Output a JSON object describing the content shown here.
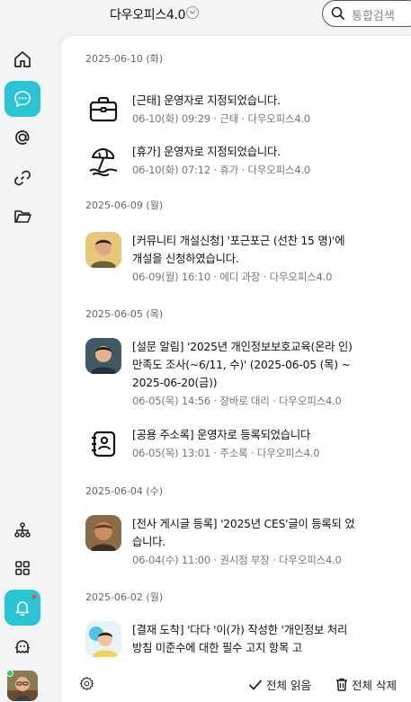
{
  "header": {
    "app_title": "다우오피스4.0",
    "search_placeholder": "통합검색"
  },
  "sidebar": {
    "items": [
      {
        "name": "home-icon"
      },
      {
        "name": "chat-icon",
        "active": true
      },
      {
        "name": "mention-icon"
      },
      {
        "name": "link-icon"
      },
      {
        "name": "folder-icon"
      }
    ],
    "bottom_items": [
      {
        "name": "org-chart-icon"
      },
      {
        "name": "apps-grid-icon"
      },
      {
        "name": "bell-icon",
        "active": true,
        "badge": true
      },
      {
        "name": "ghost-icon"
      }
    ]
  },
  "notifications": [
    {
      "date": "2025-06-10 (화)",
      "items": [
        {
          "icon": "briefcase-icon",
          "text": "[근태] 운영자로 지정되었습니다.",
          "meta": "06-10(화) 09:29 · 근태 · 다우오피스4.0"
        },
        {
          "icon": "beach-umbrella-icon",
          "text": "[휴가] 운영자로 지정되었습니다.",
          "meta": "06-10(화) 07:12 · 휴가 · 다우오피스4.0"
        }
      ]
    },
    {
      "date": "2025-06-09 (월)",
      "items": [
        {
          "icon": "avatar",
          "text": "[커뮤니티 개설신청] '포근포근 (선찬 15 명)'에 개설을 신청하였습니다.",
          "meta": "06-09(월) 16:10 · 에디 과장 · 다우오피스4.0"
        }
      ]
    },
    {
      "date": "2025-06-05 (목)",
      "items": [
        {
          "icon": "avatar",
          "text": "[설문 알림] '2025년 개인정보보호교육(온라 인) 만족도 조사(~6/11, 수)' (2025-06-05 (목) ~ 2025-06-20(금))",
          "meta": "06-05(목) 14:56 · 장바로 대리 · 다우오피스4.0"
        },
        {
          "icon": "address-book-icon",
          "text": "[공용 주소록] 운영자로 등록되었습니다",
          "meta": "06-05(목) 13:01 · 주소록 · 다우오피스4.0"
        }
      ]
    },
    {
      "date": "2025-06-04 (수)",
      "items": [
        {
          "icon": "avatar",
          "text": "[전사 게시글 등록] '2025년 CES'글이 등록되 었습니다.",
          "meta": "06-04(수) 11:00 · 권시정 부장 · 다우오피스4.0"
        }
      ]
    },
    {
      "date": "2025-06-02 (월)",
      "items": [
        {
          "icon": "avatar",
          "text": "[결재 도착] '다다 '이(가) 작성한 '개인정보 처리방침 미준수에 대한 필수 고지 항목 고",
          "meta": ""
        }
      ]
    }
  ],
  "footer": {
    "mark_all_read": "전체 읽음",
    "delete_all": "전체 삭제"
  },
  "colors": {
    "accent": "#2bc4d4",
    "badge": "#ff3b3b",
    "online": "#37c45a"
  }
}
